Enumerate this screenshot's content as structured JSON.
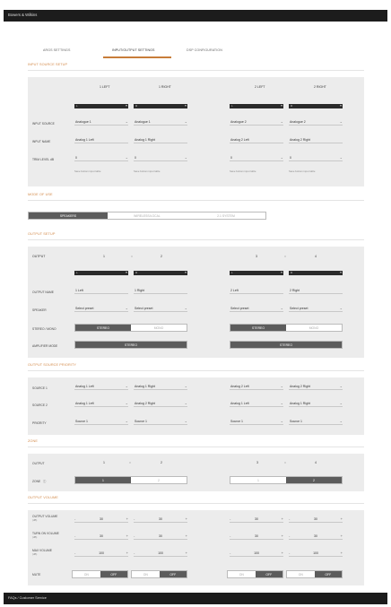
{
  "brand": "Bowers & Wilkins",
  "tabs": [
    "ARGS SETTINGS",
    "INPUT/OUTPUT SETTINGS",
    "DSP CONFIGURATION"
  ],
  "input_source_setup": {
    "title": "INPUT SOURCE SETUP",
    "headers": [
      "1 LEFT",
      "1 RIGHT",
      "2 LEFT",
      "2 RIGHT"
    ],
    "blk_labels": [
      "L",
      "R",
      "L",
      "R"
    ],
    "row_labels": [
      "INPUT SOURCE",
      "INPUT NAME",
      "TRIM LEVEL dB"
    ],
    "sources": [
      "Analogue 1",
      "Analogue 1",
      "Analogue 2",
      "Analogue 2"
    ],
    "names": [
      "Analog 1 Left",
      "Analog 1 Right",
      "Analog 2 Left",
      "Analog 2 Right"
    ],
    "trims": [
      "0",
      "0",
      "0",
      "0"
    ],
    "hint": "Save bottom input table"
  },
  "mode_of_use": {
    "title": "MODE OF USE",
    "options": [
      "SPEAKERS",
      "WIRELESS/LOCAL",
      "2.1 SYSTEM"
    ],
    "active": "SPEAKERS"
  },
  "output_setup": {
    "title": "OUTPUT SETUP",
    "output_label": "OUTPUT",
    "numbers": [
      "1",
      "2",
      "3",
      "4"
    ],
    "link_glyph": "::",
    "blk_labels": [
      "L",
      "R",
      "L",
      "R"
    ],
    "row_labels": [
      "OUTPUT NAME",
      "SPEAKER",
      "STEREO / MONO",
      "AMPLIFIER MODE"
    ],
    "names": [
      "1 Left",
      "1 Right",
      "2 Left",
      "2 Right"
    ],
    "speaker": [
      "Select preset",
      "Select preset",
      "Select preset",
      "Select preset"
    ],
    "stereo_label": "STEREO",
    "mono_label": "MONO",
    "amp_mode": [
      "STEREO",
      "STEREO"
    ]
  },
  "output_source_priority": {
    "title": "OUTPUT SOURCE PRIORITY",
    "row_labels": [
      "SOURCE 1",
      "SOURCE 2",
      "PRIORITY"
    ],
    "source1": [
      "Analog 1 Left",
      "Analog 1 Right",
      "Analog 2 Left",
      "Analog 2 Right"
    ],
    "source2": [
      "Analog 1 Left",
      "Analog 2 Right",
      "Analog 1 Left",
      "Analog 1 Right"
    ],
    "priority": [
      "Source 1",
      "Source 1",
      "Source 1",
      "Source 1"
    ]
  },
  "zone": {
    "title": "ZONE",
    "row_labels": [
      "OUTPUT",
      "ZONE"
    ],
    "info_glyph": "ⓘ",
    "numbers": [
      "1",
      "2",
      "3",
      "4"
    ],
    "link_glyph": "::",
    "pair1": [
      "1",
      "2"
    ],
    "pair1_active": "1",
    "pair2": [
      "1",
      "2"
    ],
    "pair2_active": "2"
  },
  "output_volume": {
    "title": "OUTPUT VOLUME",
    "row_labels": [
      "OUTPUT VOLUME",
      "TURN ON VOLUME",
      "MAX VOLUME",
      "MUTE"
    ],
    "row_sublabel": "(dB)",
    "volume": [
      "30",
      "30",
      "30",
      "30"
    ],
    "turn_on": [
      "30",
      "30",
      "30",
      "30"
    ],
    "max": [
      "100",
      "100",
      "100",
      "100"
    ],
    "minus": "-",
    "plus": "+",
    "on_label": "ON",
    "off_label": "OFF",
    "mute_active": [
      "OFF",
      "OFF",
      "OFF",
      "OFF"
    ]
  },
  "footer": "FAQs / Customer Service",
  "colors": {
    "accent": "#c87d3a",
    "section_title": "#d38a4a",
    "panel": "#ececec",
    "active": "#5c5c5c",
    "dark": "#1c1c1c"
  }
}
